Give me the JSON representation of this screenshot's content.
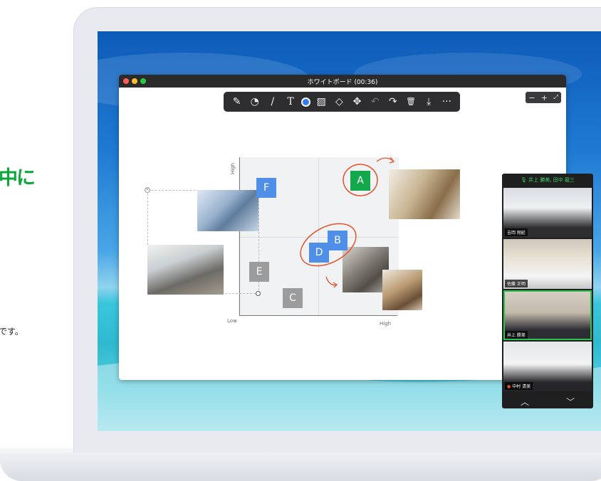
{
  "page": {
    "heading_fragment": "中に",
    "body_fragment": "です。"
  },
  "window": {
    "title": "ホワイトボード (00:36)",
    "toolbar": {
      "tools": [
        {
          "icon": "pen-icon",
          "glyph": "✎"
        },
        {
          "icon": "shapes-icon",
          "glyph": "◔"
        },
        {
          "icon": "line-icon",
          "glyph": "/"
        },
        {
          "icon": "text-icon",
          "glyph": "T"
        },
        {
          "icon": "color-picker-icon",
          "glyph": ""
        },
        {
          "icon": "image-icon",
          "glyph": "▨"
        },
        {
          "icon": "eraser-icon",
          "glyph": "◇"
        },
        {
          "icon": "move-icon",
          "glyph": "✥"
        },
        {
          "icon": "undo-icon",
          "glyph": "↶"
        },
        {
          "icon": "redo-icon",
          "glyph": "↷"
        },
        {
          "icon": "trash-icon",
          "glyph": "🗑"
        },
        {
          "icon": "download-icon",
          "glyph": "⤓"
        },
        {
          "icon": "more-icon",
          "glyph": "···"
        }
      ],
      "active_color": "#2f7cf6"
    },
    "zoom": {
      "minus": "−",
      "plus": "+",
      "expand": "⤢"
    }
  },
  "whiteboard": {
    "y_axis_label": "High",
    "x_low_label": "Low",
    "x_high_label": "High",
    "items": {
      "A": "A",
      "B": "B",
      "C": "C",
      "D": "D",
      "E": "E",
      "F": "F"
    }
  },
  "video_panel": {
    "header": "井上 勝美, 田中 龍三",
    "participants": [
      {
        "name": "吉岡 翔延"
      },
      {
        "name": "佐藤 正明"
      },
      {
        "name": "井上 勝美"
      },
      {
        "name": "中村 清美"
      }
    ],
    "nav_up": "︿",
    "nav_down": "﹀"
  }
}
